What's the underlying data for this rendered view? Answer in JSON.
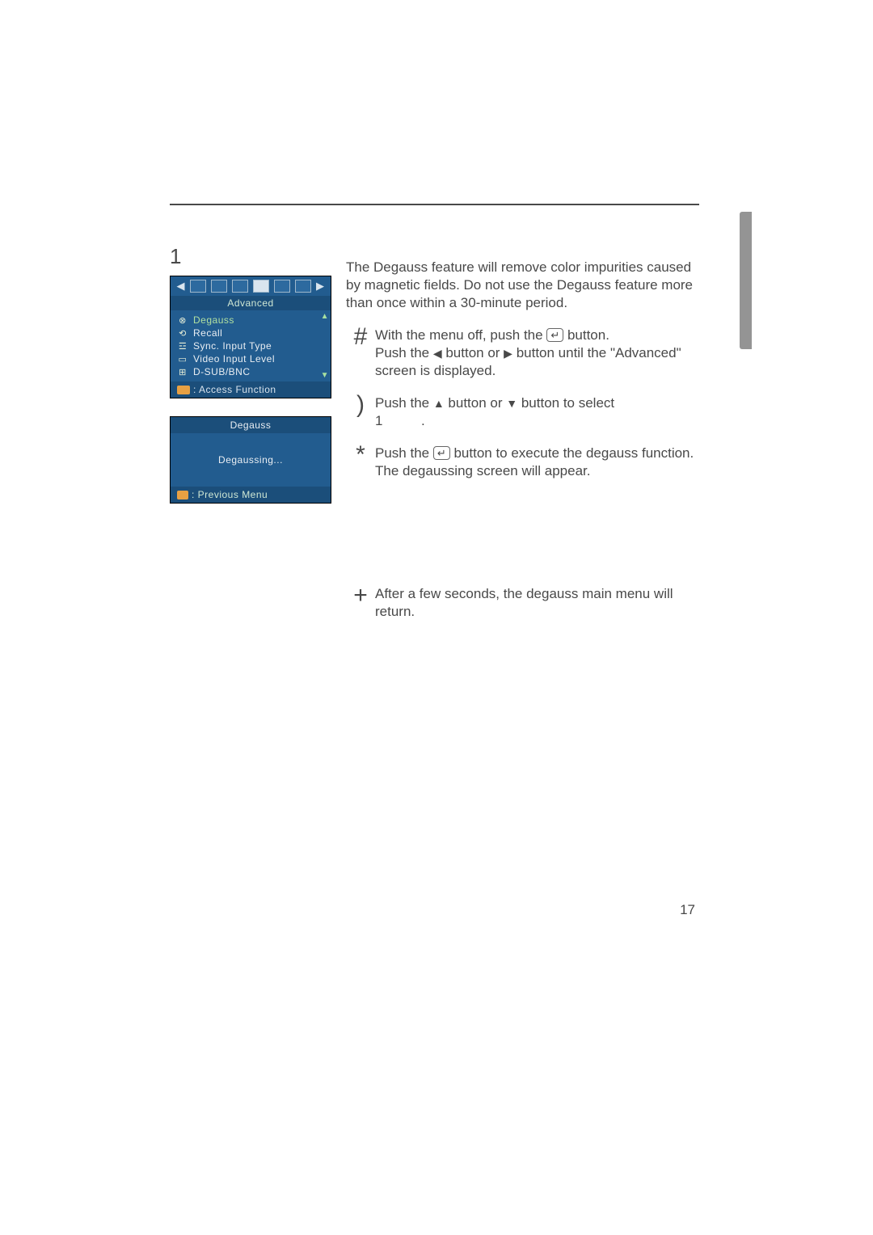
{
  "page_number": "17",
  "tab_index": "1",
  "osd1": {
    "header_title": "Advanced",
    "items": {
      "degauss": "Degauss",
      "recall": "Recall",
      "sync_input_type": "Sync. Input Type",
      "video_input_level": "Video Input Level",
      "dsub_bnc": "D-SUB/BNC"
    },
    "hint_label": ": Access Function"
  },
  "osd2": {
    "title": "Degauss",
    "body": "Degaussing...",
    "hint_label": ": Previous Menu"
  },
  "intro": "The Degauss feature will remove color impurities caused by magnetic fields. Do not use the Degauss feature more than once within a 30-minute period.",
  "steps": {
    "s1": {
      "mark": "#",
      "line1_a": "With the menu off, push the ",
      "line1_b": " button.",
      "line2_a": "Push the ",
      "line2_b": " button or ",
      "line2_c": " button until the \"Advanced\" screen is displayed."
    },
    "s2": {
      "mark": ")",
      "line1_a": "Push the ",
      "line1_b": " button or ",
      "line1_c": " button to select",
      "line2_num": "1",
      "line2_dot": "."
    },
    "s3": {
      "mark": "*",
      "line1_a": "Push the ",
      "line1_b": " button to execute the degauss function. The degaussing screen will appear."
    },
    "s4": {
      "mark": "+",
      "text": "After a few seconds, the degauss main menu will return."
    }
  },
  "icons": {
    "enter": "↵",
    "left": "◀",
    "right": "▶",
    "up": "▲",
    "down": "▼"
  }
}
